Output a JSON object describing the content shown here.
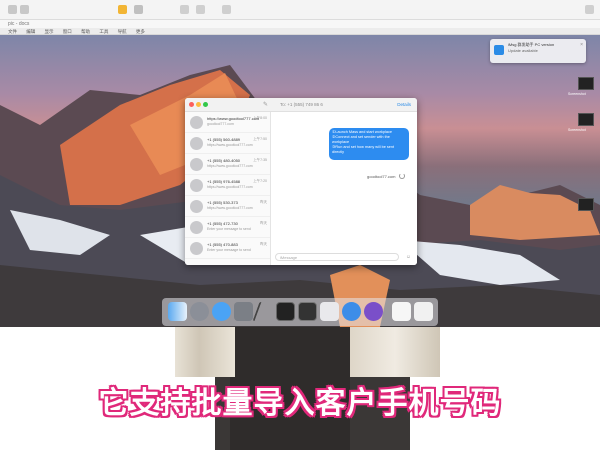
{
  "host": {
    "title": "pic - docs",
    "menu": [
      "文件",
      "编辑",
      "显示",
      "窗口",
      "帮助",
      "工具",
      "导航",
      "更多"
    ]
  },
  "notification": {
    "title": "iMsg 群发助手 PC version",
    "body": "Update available",
    "close": "×"
  },
  "thumbnails": [
    {
      "label": "Screenshot"
    },
    {
      "label": "Screenshot"
    },
    {
      "label": ""
    }
  ],
  "messages_window": {
    "search_placeholder": "Search",
    "recipient": "To: +1 (555) 749 86 6",
    "details": "Details",
    "conversations": [
      {
        "name": "https://www.goodtool777.com",
        "time": "上午8:00",
        "preview": "goodtool777.com"
      },
      {
        "name": "+1 (555) 560-4889",
        "time": "上午7:50",
        "preview": "https://www.goodtool777.com"
      },
      {
        "name": "+1 (555) 480-4050",
        "time": "上午7:35",
        "preview": "https://www.goodtool777.com"
      },
      {
        "name": "+1 (555) 976-4588",
        "time": "上午7:20",
        "preview": "https://www.goodtool777.com"
      },
      {
        "name": "+1 (555) 530-373",
        "time": "昨天",
        "preview": "https://www.goodtool777.com"
      },
      {
        "name": "+1 (555) 472-730",
        "time": "昨天",
        "preview": "Enter your message to send"
      },
      {
        "name": "+1 (555) 470-883",
        "time": "昨天",
        "preview": "Enter your message to send"
      }
    ],
    "bubble_lines": [
      "①Launch Mass and start workplace",
      "②Connect and set sender with the",
      "  workplace",
      "③Run and set how many will be sent",
      "  directly"
    ],
    "sent_link": "goodtool77.com",
    "input_placeholder": "iMessage"
  },
  "subtitle": "它支持批量导入客户手机号码",
  "colors": {
    "accent_blue": "#2d8cf0",
    "subtitle_stroke": "#e0287a"
  }
}
